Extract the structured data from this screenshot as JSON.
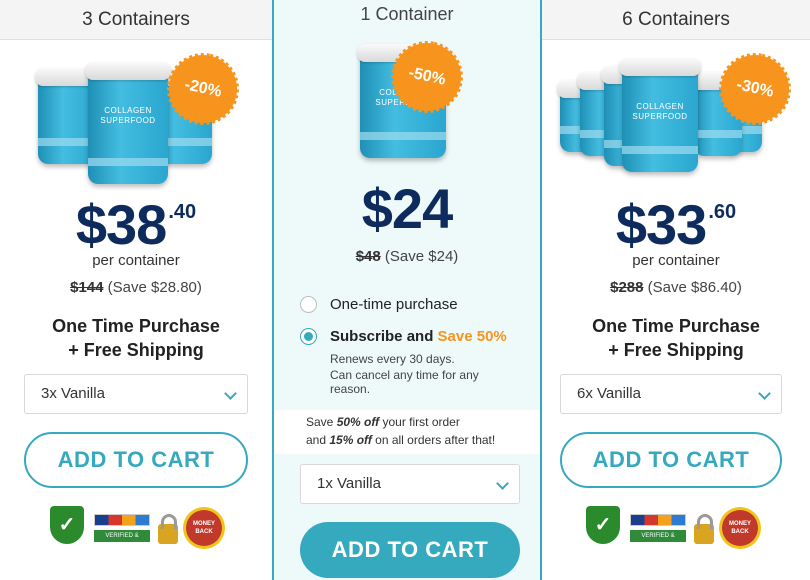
{
  "left_card": {
    "title": "3 Containers",
    "badge": "-20%",
    "jar_label": "COLLAGEN SUPERFOOD",
    "price_whole": "$38",
    "price_cents": ".40",
    "per_label": "per container",
    "original_price": "$144",
    "save_text": "(Save $28.80)",
    "purchase_line1": "One Time Purchase",
    "purchase_line2": "+ Free Shipping",
    "select_value": "3x Vanilla",
    "cart_label": "ADD TO CART"
  },
  "mid_card": {
    "title": "1 Container",
    "badge": "-50%",
    "jar_label": "COLLAGEN SUPERFOOD",
    "price": "$24",
    "original_price": "$48",
    "save_text": "(Save $24)",
    "option_onetime": "One-time purchase",
    "option_subscribe": "Subscribe and ",
    "option_subscribe_accent": "Save 50%",
    "renews": "Renews every 30 days.",
    "cancel": "Can cancel any time for any reason.",
    "promo_pre1": "Save ",
    "promo_b1": "50% off",
    "promo_post1": " your first order",
    "promo_pre2": "and ",
    "promo_b2": "15% off",
    "promo_post2": " on all orders after that!",
    "select_value": "1x Vanilla",
    "cart_label": "ADD TO CART"
  },
  "right_card": {
    "title": "6 Containers",
    "badge": "-30%",
    "jar_label": "COLLAGEN SUPERFOOD",
    "price_whole": "$33",
    "price_cents": ".60",
    "per_label": "per container",
    "original_price": "$288",
    "save_text": "(Save $86.40)",
    "purchase_line1": "One Time Purchase",
    "purchase_line2": "+ Free Shipping",
    "select_value": "6x Vanilla",
    "cart_label": "ADD TO CART"
  },
  "trust": {
    "verified": "VERIFIED & SECURED",
    "moneyback": "MONEY BACK"
  },
  "colors": {
    "accent": "#35a9be",
    "badge": "#f7941d",
    "price": "#0d2b5c"
  }
}
